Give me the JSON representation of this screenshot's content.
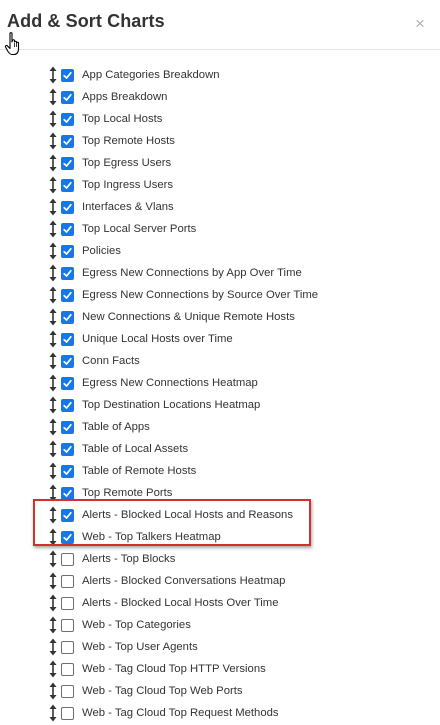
{
  "dialog": {
    "title": "Add & Sort Charts",
    "close_label": "×"
  },
  "colors": {
    "checkbox_checked": "#1877e8",
    "highlight_border": "#d22f2f"
  },
  "icons": {
    "drag_handle": "vertical-arrows-icon",
    "cursor": "hand-pointer-icon",
    "close": "close-icon"
  },
  "charts": [
    {
      "label": "App Categories Breakdown",
      "checked": true
    },
    {
      "label": "Apps Breakdown",
      "checked": true
    },
    {
      "label": "Top Local Hosts",
      "checked": true
    },
    {
      "label": "Top Remote Hosts",
      "checked": true
    },
    {
      "label": "Top Egress Users",
      "checked": true
    },
    {
      "label": "Top Ingress Users",
      "checked": true
    },
    {
      "label": "Interfaces & Vlans",
      "checked": true
    },
    {
      "label": "Top Local Server Ports",
      "checked": true
    },
    {
      "label": "Policies",
      "checked": true
    },
    {
      "label": "Egress New Connections by App Over Time",
      "checked": true
    },
    {
      "label": "Egress New Connections by Source Over Time",
      "checked": true
    },
    {
      "label": "New Connections & Unique Remote Hosts",
      "checked": true
    },
    {
      "label": "Unique Local Hosts over Time",
      "checked": true
    },
    {
      "label": "Conn Facts",
      "checked": true
    },
    {
      "label": "Egress New Connections Heatmap",
      "checked": true
    },
    {
      "label": "Top Destination Locations Heatmap",
      "checked": true
    },
    {
      "label": "Table of Apps",
      "checked": true
    },
    {
      "label": "Table of Local Assets",
      "checked": true
    },
    {
      "label": "Table of Remote Hosts",
      "checked": true
    },
    {
      "label": "Top Remote Ports",
      "checked": true
    },
    {
      "label": "Alerts - Blocked Local Hosts and Reasons",
      "checked": true,
      "highlighted": true
    },
    {
      "label": "Web - Top Talkers Heatmap",
      "checked": true,
      "highlighted": true
    },
    {
      "label": "Alerts - Top Blocks",
      "checked": false
    },
    {
      "label": "Alerts - Blocked Conversations Heatmap",
      "checked": false
    },
    {
      "label": "Alerts - Blocked Local Hosts Over Time",
      "checked": false
    },
    {
      "label": "Web - Top Categories",
      "checked": false
    },
    {
      "label": "Web - Top User Agents",
      "checked": false
    },
    {
      "label": "Web - Tag Cloud Top HTTP Versions",
      "checked": false
    },
    {
      "label": "Web - Tag Cloud Top Web Ports",
      "checked": false
    },
    {
      "label": "Web - Tag Cloud Top Request Methods",
      "checked": false
    }
  ]
}
